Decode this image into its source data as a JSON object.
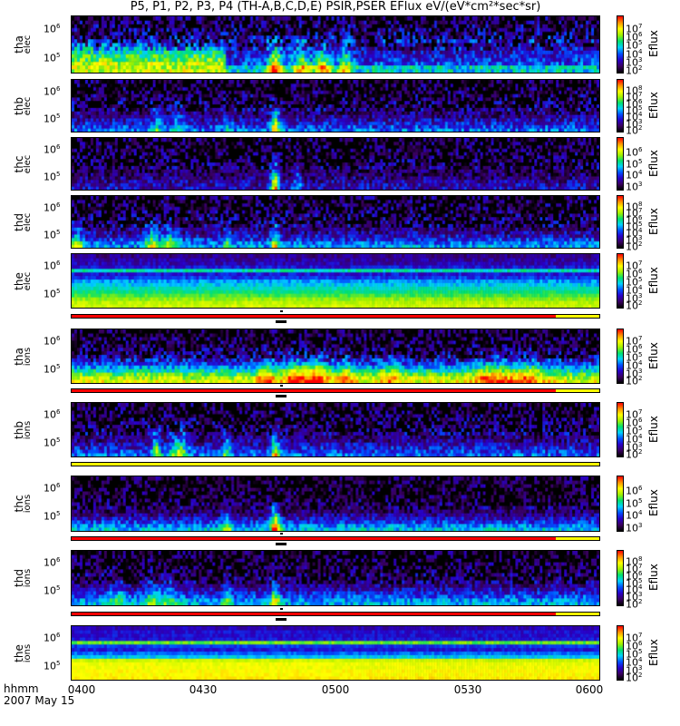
{
  "chart_data": {
    "type": "heatmap",
    "title": "P5, P1, P2, P3, P4 (TH-A,B,C,D,E) PSIR,PSER EFlux eV/(eV*cm²*sec*sr)",
    "x_tick_labels": [
      "0400",
      "0430",
      "0500",
      "0530",
      "0600"
    ],
    "x_axis_label": "hhmm",
    "date_label": "2007 May 15",
    "xlim_minutes": [
      0,
      120
    ],
    "colorbar_label": "Eflux",
    "panels": [
      {
        "id": "tha_elec",
        "label": [
          "tha",
          "elec"
        ],
        "yticks": [
          "10^6",
          "10^5"
        ],
        "cbar_exp": [
          2,
          3,
          4,
          5,
          6,
          7
        ],
        "base": [
          0.72,
          0.72,
          0.7,
          0.62,
          0.58,
          0.5,
          0.4,
          0.3,
          0.22,
          0.18,
          0.14,
          0.12,
          0.1,
          0.08,
          0.06
        ],
        "drop_after_min": 35,
        "drop_level": 0.45,
        "noise": 0.25,
        "spikes": [
          [
            46,
            1.5,
            0.6
          ],
          [
            52,
            2,
            0.45
          ],
          [
            57,
            2,
            0.45
          ],
          [
            62,
            1.5,
            0.4
          ]
        ]
      },
      {
        "id": "thb_elec",
        "label": [
          "thb",
          "elec"
        ],
        "yticks": [
          "10^6",
          "10^5"
        ],
        "cbar_exp": [
          2,
          3,
          4,
          5,
          6,
          7,
          8
        ],
        "base": [
          0.35,
          0.3,
          0.25,
          0.2,
          0.16,
          0.14,
          0.12,
          0.1,
          0.1,
          0.08,
          0.08,
          0.06,
          0.06,
          0.05,
          0.05
        ],
        "noise": 0.25,
        "spikes": [
          [
            19,
            1,
            0.25
          ],
          [
            24,
            1.5,
            0.2
          ],
          [
            35,
            1,
            0.15
          ],
          [
            46,
            1,
            0.55
          ]
        ]
      },
      {
        "id": "thc_elec",
        "label": [
          "thc",
          "elec"
        ],
        "yticks": [
          "10^6",
          "10^5"
        ],
        "cbar_exp": [
          3,
          4,
          5,
          6
        ],
        "base": [
          0.22,
          0.2,
          0.18,
          0.15,
          0.12,
          0.1,
          0.1,
          0.08,
          0.08,
          0.06,
          0.06,
          0.05,
          0.05,
          0.05,
          0.05
        ],
        "noise": 0.25,
        "spikes": [
          [
            46,
            1,
            0.65
          ],
          [
            51,
            1,
            0.25
          ]
        ]
      },
      {
        "id": "thd_elec",
        "label": [
          "thd",
          "elec"
        ],
        "yticks": [
          "10^6",
          "10^5"
        ],
        "cbar_exp": [
          2,
          3,
          4,
          5,
          6,
          7,
          8
        ],
        "base": [
          0.4,
          0.35,
          0.28,
          0.22,
          0.18,
          0.14,
          0.12,
          0.1,
          0.1,
          0.08,
          0.08,
          0.06,
          0.06,
          0.05,
          0.05
        ],
        "noise": 0.25,
        "spikes": [
          [
            1,
            1.5,
            0.3
          ],
          [
            18,
            1.5,
            0.35
          ],
          [
            22,
            2,
            0.3
          ],
          [
            35,
            1,
            0.25
          ],
          [
            46,
            1,
            0.4
          ]
        ]
      },
      {
        "id": "the_elec",
        "label": [
          "the",
          "elec"
        ],
        "yticks": [
          "10^6",
          "10^5"
        ],
        "cbar_exp": [
          2,
          3,
          4,
          5,
          6,
          7
        ],
        "base": [
          0.72,
          0.7,
          0.66,
          0.6,
          0.55,
          0.5,
          0.45,
          0.4,
          0.3,
          0.25,
          0.5,
          0.25,
          0.2,
          0.18,
          0.15
        ],
        "noise": 0.08,
        "spikes": []
      },
      {
        "id": "tha_ions",
        "label": [
          "tha",
          "ions"
        ],
        "yticks": [
          "10^6",
          "10^5"
        ],
        "cbar_exp": [
          2,
          3,
          4,
          5,
          6,
          7
        ],
        "base": [
          0.75,
          0.7,
          0.6,
          0.5,
          0.4,
          0.3,
          0.22,
          0.18,
          0.14,
          0.12,
          0.1,
          0.08,
          0.08,
          0.06,
          0.06
        ],
        "noise": 0.22,
        "spikes": [
          [
            44,
            2,
            0.3
          ],
          [
            50,
            2,
            0.3
          ],
          [
            55,
            3,
            0.35
          ],
          [
            62,
            2,
            0.2
          ],
          [
            72,
            2,
            0.2
          ],
          [
            95,
            4,
            0.25
          ],
          [
            103,
            4,
            0.25
          ]
        ]
      },
      {
        "id": "thb_ions",
        "label": [
          "thb",
          "ions"
        ],
        "yticks": [
          "10^6",
          "10^5"
        ],
        "cbar_exp": [
          2,
          3,
          4,
          5,
          6,
          7
        ],
        "base": [
          0.35,
          0.3,
          0.25,
          0.2,
          0.16,
          0.14,
          0.12,
          0.1,
          0.1,
          0.08,
          0.08,
          0.06,
          0.06,
          0.05,
          0.05
        ],
        "noise": 0.25,
        "spikes": [
          [
            19,
            1,
            0.4
          ],
          [
            24,
            2,
            0.4
          ],
          [
            35,
            1,
            0.3
          ],
          [
            46,
            1,
            0.5
          ]
        ]
      },
      {
        "id": "thc_ions",
        "label": [
          "thc",
          "ions"
        ],
        "yticks": [
          "10^6",
          "10^5"
        ],
        "cbar_exp": [
          3,
          4,
          5,
          6
        ],
        "base": [
          0.45,
          0.38,
          0.3,
          0.22,
          0.16,
          0.12,
          0.1,
          0.08,
          0.08,
          0.06,
          0.06,
          0.05,
          0.05,
          0.05,
          0.05
        ],
        "noise": 0.22,
        "spikes": [
          [
            35,
            1,
            0.3
          ],
          [
            46,
            1,
            0.6
          ]
        ]
      },
      {
        "id": "thd_ions",
        "label": [
          "thd",
          "ions"
        ],
        "yticks": [
          "10^6",
          "10^5"
        ],
        "cbar_exp": [
          2,
          3,
          4,
          5,
          6,
          7,
          8
        ],
        "base": [
          0.42,
          0.38,
          0.32,
          0.26,
          0.2,
          0.16,
          0.12,
          0.1,
          0.1,
          0.08,
          0.08,
          0.06,
          0.06,
          0.05,
          0.05
        ],
        "noise": 0.22,
        "spikes": [
          [
            10,
            2,
            0.2
          ],
          [
            18,
            2,
            0.25
          ],
          [
            22,
            2,
            0.2
          ],
          [
            35,
            1,
            0.25
          ],
          [
            46,
            1,
            0.4
          ]
        ]
      },
      {
        "id": "the_ions",
        "label": [
          "the",
          "ions"
        ],
        "yticks": [
          "10^6",
          "10^5"
        ],
        "cbar_exp": [
          2,
          3,
          4,
          5,
          6,
          7
        ],
        "base": [
          0.8,
          0.78,
          0.78,
          0.76,
          0.76,
          0.72,
          0.45,
          0.35,
          0.25,
          0.3,
          0.62,
          0.25,
          0.24,
          0.24,
          0.2
        ],
        "noise": 0.06,
        "spikes": []
      }
    ],
    "mode_bars": [
      {
        "after": "the_elec",
        "segments": [
          {
            "from": 0,
            "to": 110,
            "color": "#ff0000"
          },
          {
            "from": 110,
            "to": 120,
            "color": "#ffff00"
          }
        ],
        "marker": [
          46.5,
          49
        ]
      },
      {
        "after": "tha_ions",
        "segments": [
          {
            "from": 0,
            "to": 110,
            "color": "#ff0000"
          },
          {
            "from": 110,
            "to": 120,
            "color": "#ffff00"
          }
        ],
        "marker": [
          46.5,
          49
        ]
      },
      {
        "after": "thb_ions",
        "segments": [
          {
            "from": 0,
            "to": 120,
            "color": "#ffff00"
          }
        ],
        "marker": null
      },
      {
        "after": "thc_ions",
        "segments": [
          {
            "from": 0,
            "to": 110,
            "color": "#ff0000"
          },
          {
            "from": 110,
            "to": 120,
            "color": "#ffff00"
          }
        ],
        "marker": [
          46.5,
          49
        ]
      },
      {
        "after": "thd_ions",
        "segments": [
          {
            "from": 0,
            "to": 110,
            "color": "#ff0000"
          },
          {
            "from": 110,
            "to": 120,
            "color": "#ffff00"
          }
        ],
        "marker": [
          46.5,
          49
        ]
      }
    ]
  }
}
